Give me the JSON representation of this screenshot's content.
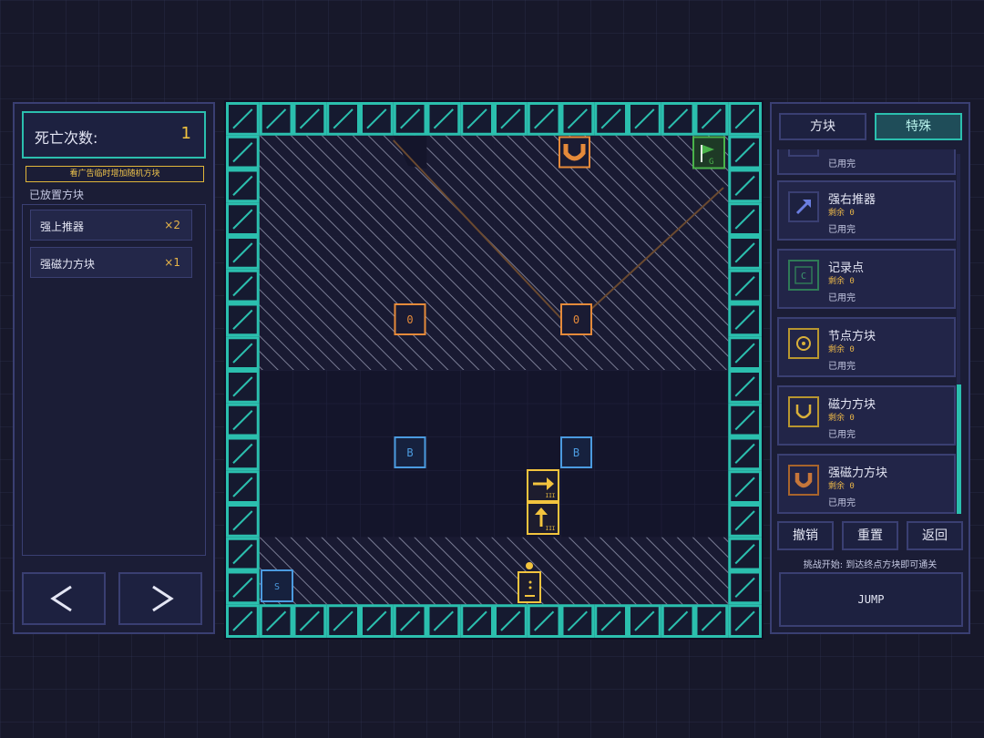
{
  "left": {
    "death_label": "死亡次数:",
    "death_count": "1",
    "ad_notice": "看广告临时增加随机方块",
    "placed_label": "已放置方块",
    "placed_items": [
      {
        "name": "强上推器",
        "qty": "×2"
      },
      {
        "name": "强磁力方块",
        "qty": "×1"
      }
    ],
    "prev_icon": "chevron-left-icon",
    "next_icon": "chevron-right-icon"
  },
  "board": {
    "start_label": "S",
    "goal_label": "G",
    "bouncer_label": "B",
    "zero_label": "0",
    "pusher_tag": "III"
  },
  "right": {
    "tabs": [
      "方块",
      "特殊"
    ],
    "active_tab": "特殊",
    "inventory": [
      {
        "name": "",
        "remain": "",
        "status": "已用完"
      },
      {
        "name": "强右推器",
        "remain": "剩余 0",
        "status": "已用完",
        "icon": "arrow-up-right-icon"
      },
      {
        "name": "记录点",
        "remain": "剩余 0",
        "status": "已用完",
        "icon": "checkpoint-icon",
        "icon_letter": "C"
      },
      {
        "name": "节点方块",
        "remain": "剩余 0",
        "status": "已用完",
        "icon": "node-icon"
      },
      {
        "name": "磁力方块",
        "remain": "剩余 0",
        "status": "已用完",
        "icon": "magnet-icon"
      },
      {
        "name": "强磁力方块",
        "remain": "剩余 0",
        "status": "已用完",
        "icon": "strong-magnet-icon"
      }
    ],
    "undo": "撤销",
    "reset": "重置",
    "back": "返回",
    "hint": "挑战开始: 到达终点方块即可通关",
    "jump": "JUMP"
  },
  "colors": {
    "wall": "#2bbfae",
    "bouncer": "#4b9be0",
    "orange": "#e58a3a",
    "yellow": "#f3c43e",
    "goal": "#4ab34a"
  }
}
